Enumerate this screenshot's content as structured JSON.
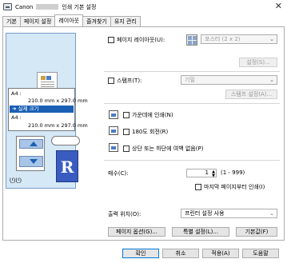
{
  "window": {
    "title_prefix": "Canon",
    "title_suffix": "인쇄 기본 설정",
    "close_glyph": "✕"
  },
  "tabs": [
    {
      "label": "기본"
    },
    {
      "label": "페이지 설정"
    },
    {
      "label": "레이아웃"
    },
    {
      "label": "즐겨찾기"
    },
    {
      "label": "유지 관리"
    }
  ],
  "preview": {
    "sizes": {
      "line1": "A4 :",
      "line2": "210.0 mm x 297.0 mm",
      "selected": "➔ 실제 크기",
      "line3": "A4 :",
      "line4": "210.0 mm x 297.0 mm"
    },
    "orientation_glyph": "R",
    "glasses_glyph": "ᘎᘎ"
  },
  "page_layout": {
    "label": "페이지 레이아웃(U):",
    "value": "포스터 (2 x 2)",
    "settings_button": "설정(S)..."
  },
  "stamp": {
    "label": "스탬프(T):",
    "value": "기밀",
    "settings_button": "스탬프 설정(A)..."
  },
  "options": {
    "center": "가운데에 인쇄(N)",
    "rotate180": "180도 회전(R)",
    "margins": "상단 또는 하단에 여백 없음(P)"
  },
  "copies": {
    "label": "매수(C):",
    "value": "1",
    "range": "(1 - 999)",
    "last_page_first": "마지막 페이지부터 인쇄(I)"
  },
  "output": {
    "label": "출력 위치(O):",
    "value": "프린터 설정 사용"
  },
  "bottom_buttons": {
    "page_options": "페이지 옵션(G)...",
    "special_settings": "특별 설정(L)...",
    "defaults": "기본값(F)"
  },
  "dialog_buttons": {
    "ok": "확인",
    "cancel": "취소",
    "apply": "적용(A)",
    "help": "도움말"
  },
  "glyphs": {
    "dropdown": "⌄",
    "spin_up": "▲",
    "spin_down": "▼"
  }
}
